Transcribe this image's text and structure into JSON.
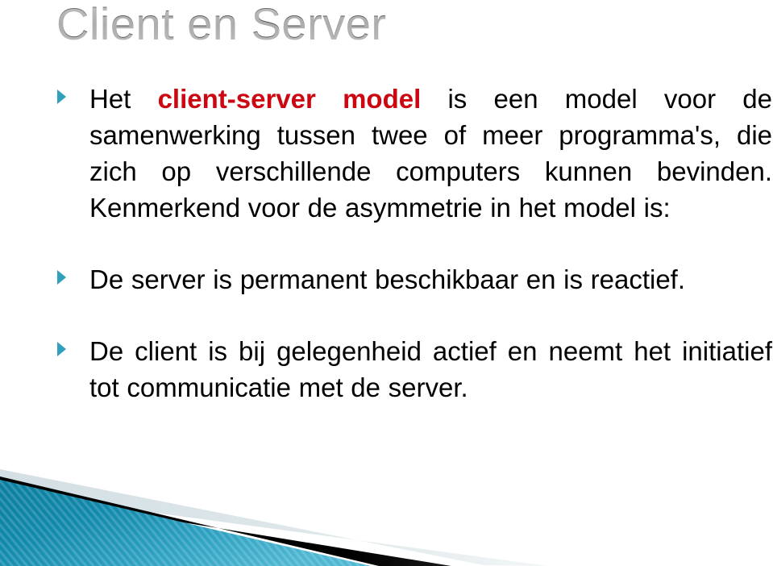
{
  "slide": {
    "title": "Client en Server",
    "title_color": "#595959",
    "background_color": "#ffffff",
    "accent_color": "#31A0BE",
    "highlight_color": "#CC0711",
    "body_text_color": "#000000",
    "decoration_teal_dark": "#0F86A8",
    "decoration_teal_light": "#3FAFCC",
    "decoration_black": "#000000",
    "decoration_pale": "#DDE6E9"
  },
  "bullets": [
    {
      "marker": "triangle-right-bullet",
      "lead_text": "Het ",
      "highlight_text": "client-server model",
      "tail_text": " is een model voor de samenwerking tussen twee of meer programma's, die zich op verschillende computers kunnen bevinden. Kenmerkend voor de asymmetrie in het model is:",
      "full_text": "Het client-server model is een model voor de samenwerking tussen twee of meer programma's, die zich op verschillende computers kunnen bevinden. Kenmerkend voor de asymmetrie in het model is:"
    },
    {
      "marker": "triangle-right-bullet",
      "lead_text": "",
      "highlight_text": "",
      "tail_text": "De server is permanent beschikbaar en is reactief.",
      "full_text": "De server is permanent beschikbaar en is reactief."
    },
    {
      "marker": "triangle-right-bullet",
      "lead_text": "",
      "highlight_text": "",
      "tail_text": "De client is bij gelegenheid actief en neemt het initiatief tot communicatie met de server.",
      "full_text": "De client is bij gelegenheid actief en neemt het initiatief tot communicatie met de server."
    }
  ]
}
